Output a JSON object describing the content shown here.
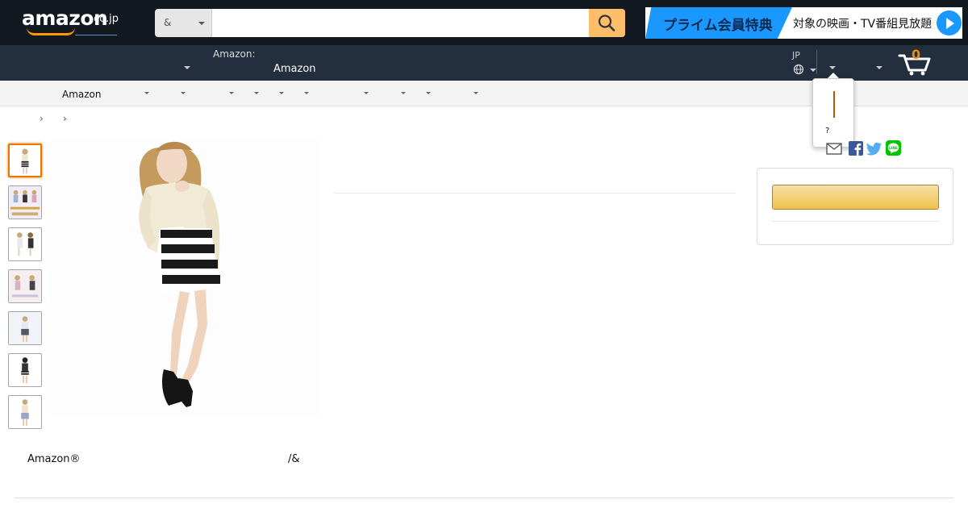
{
  "header": {
    "logo_text": "amazon",
    "logo_tld": ".co.jp",
    "search_category": "&",
    "search_placeholder": "",
    "prime_banner": {
      "highlight": "プライム会員特典",
      "text": "対象の映画・TV番組見放題"
    },
    "cart_count": "0"
  },
  "nav_bottom": {
    "amazon_prefix": "Amazon:",
    "amazon_label": "Amazon",
    "locale_code": "JP"
  },
  "subnav": {
    "label": "Amazon"
  },
  "breadcrumb": {
    "separators": [
      "›",
      "›"
    ]
  },
  "popover": {
    "question_mark": "?"
  },
  "product": {
    "thumbnail_count": 7,
    "bottom_left_text": "Amazon®",
    "bottom_right_text": "/&"
  },
  "colors": {
    "nav_dark": "#131921",
    "nav_secondary": "#232f3e",
    "search_button": "#febd69",
    "prime_blue": "#1a98ff",
    "cart_count": "#f08804",
    "thumb_active": "#e77600",
    "cart_button_top": "#f7dfa5",
    "cart_button_bottom": "#f0c14b"
  },
  "icons": [
    "search-icon",
    "cart-icon",
    "globe-icon",
    "email-share-icon",
    "facebook-icon",
    "twitter-icon",
    "line-icon",
    "play-icon"
  ]
}
